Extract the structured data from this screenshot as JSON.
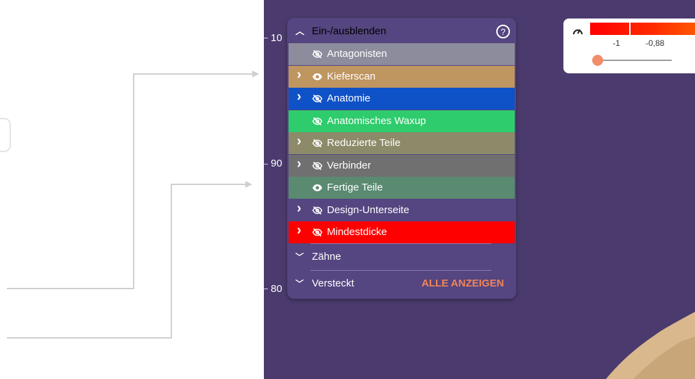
{
  "ruler": {
    "top": "10",
    "middle": "90",
    "bottom": "80"
  },
  "panel": {
    "header": "Ein-/ausblenden",
    "help_glyph": "?",
    "rows": [
      {
        "label": "Antagonisten",
        "color": "#8c8c9c",
        "chevron": false,
        "eye": "hidden"
      },
      {
        "label": "Kieferscan",
        "color": "#bf9560",
        "chevron": true,
        "eye": "visible"
      },
      {
        "label": "Anatomie",
        "color": "#0f52c8",
        "chevron": true,
        "eye": "hidden"
      },
      {
        "label": "Anatomisches Waxup",
        "color": "#2ecc6c",
        "chevron": false,
        "eye": "hidden"
      },
      {
        "label": "Reduzierte Teile",
        "color": "#8c8a68",
        "chevron": true,
        "eye": "hidden"
      },
      {
        "label": "Verbinder",
        "color": "#707070",
        "chevron": true,
        "eye": "hidden"
      },
      {
        "label": "Fertige Teile",
        "color": "#5a8a70",
        "chevron": false,
        "eye": "visible"
      },
      {
        "label": "Design-Unterseite",
        "color": "#554580",
        "chevron": true,
        "eye": "hidden"
      },
      {
        "label": "Mindestdicke",
        "color": "#ff0000",
        "chevron": true,
        "eye": "hidden"
      }
    ],
    "zaehne": "Zähne",
    "versteckt": "Versteckt",
    "show_all": "ALLE ANZEIGEN"
  },
  "legend": {
    "values": [
      "-1",
      "-0,88"
    ],
    "slider": 0.0
  },
  "colors": {
    "viewport": "#4b3a6d",
    "panel": "#554580",
    "accent": "#f0855a"
  }
}
